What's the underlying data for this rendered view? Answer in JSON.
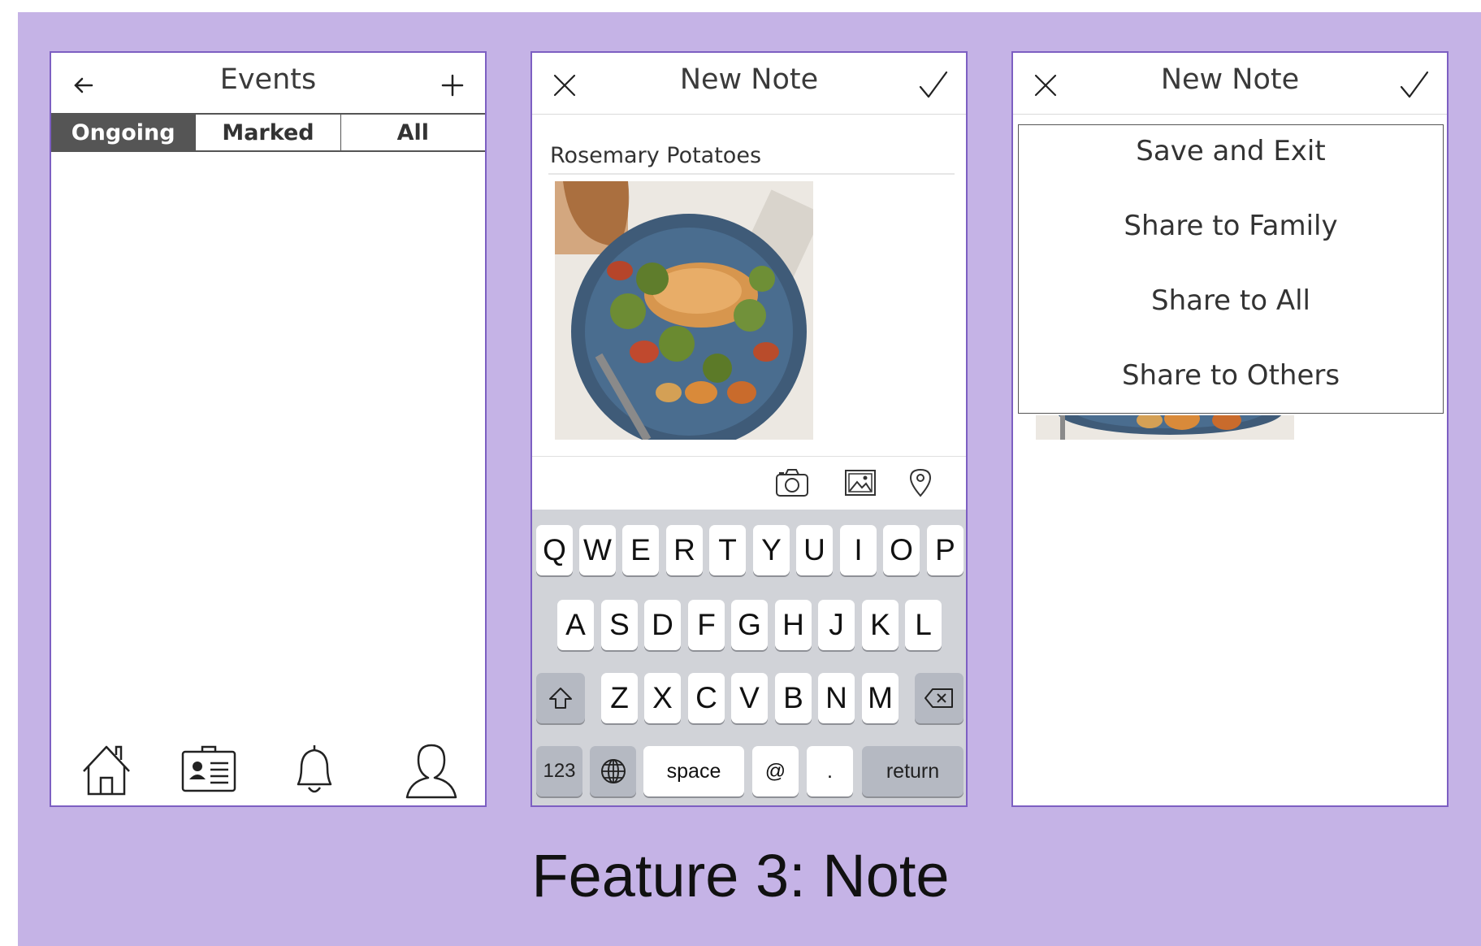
{
  "caption": "Feature 3: Note",
  "events_screen": {
    "title": "Events",
    "back_icon": "arrow-left-icon",
    "add_icon": "plus-icon",
    "tabs": [
      {
        "label": "Ongoing",
        "active": true
      },
      {
        "label": "Marked",
        "active": false
      },
      {
        "label": "All",
        "active": false
      }
    ],
    "bottom_nav": [
      "home-icon",
      "contact-card-icon",
      "bell-icon",
      "user-icon"
    ]
  },
  "new_note_screen": {
    "title": "New Note",
    "close_icon": "close-icon",
    "confirm_icon": "checkmark-icon",
    "note_title_value": "Rosemary Potatoes",
    "media_icons": [
      "camera-icon",
      "image-icon",
      "location-pin-icon"
    ],
    "keyboard": {
      "row1": [
        "Q",
        "W",
        "E",
        "R",
        "T",
        "Y",
        "U",
        "I",
        "O",
        "P"
      ],
      "row2": [
        "A",
        "S",
        "D",
        "F",
        "G",
        "H",
        "J",
        "K",
        "L"
      ],
      "row3": [
        "Z",
        "X",
        "C",
        "V",
        "B",
        "N",
        "M"
      ],
      "numbers_label": "123",
      "space_label": "space",
      "at_label": "@",
      "dot_label": ".",
      "return_label": "return"
    }
  },
  "share_menu_screen": {
    "title": "New Note",
    "menu_items": [
      "Save and Exit",
      "Share to Family",
      "Share to All",
      "Share to Others"
    ]
  },
  "colors": {
    "slide_background": "#c5b3e6",
    "phone_border": "#7d5fc2",
    "active_tab": "#555555",
    "keyboard_background": "#d1d3d8"
  }
}
